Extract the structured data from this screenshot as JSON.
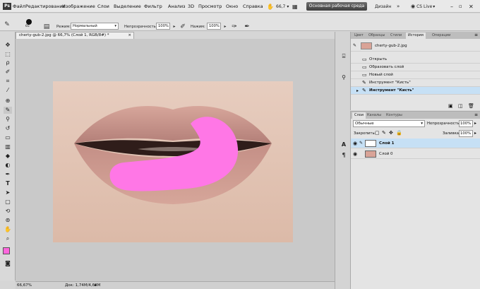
{
  "menubar": {
    "app_logo": "Ps",
    "items": [
      "Файл",
      "Редактирование",
      "Изображение",
      "Слои",
      "Выделение",
      "Фильтр",
      "Анализ",
      "3D",
      "Просмотр",
      "Окно",
      "Справка"
    ],
    "zoom": "66,7",
    "workspace": "Основная рабочая среда",
    "design": "Дизайн",
    "cs_live": "CS Live"
  },
  "options": {
    "mode_label": "Режим:",
    "mode_value": "Нормальный",
    "opacity_label": "Непрозрачность:",
    "opacity_value": "100%",
    "pressure_label": "Нажим:",
    "pressure_value": "100%",
    "brush_size": "65"
  },
  "document": {
    "tab_title": "cherty-gub-2.jpg @ 66,7% (Слой 1, RGB/8#) *",
    "close": "×"
  },
  "status": {
    "zoom": "66,67%",
    "doc_info": "Док: 1,74M/4,68M"
  },
  "history": {
    "tabs": [
      "Цвет",
      "Образцы",
      "Стили",
      "История",
      "Операции"
    ],
    "snapshot": "cherty-gub-2.jpg",
    "rows": [
      "Открыть",
      "Образовать слой",
      "Новый слой",
      "Инструмент \"Кисть\"",
      "Инструмент \"Кисть\""
    ]
  },
  "layers": {
    "tabs": [
      "Слои",
      "Каналы",
      "Контуры"
    ],
    "blend_mode": "Обычные",
    "opacity_label": "Непрозрачность:",
    "opacity_value": "100%",
    "lock_label": "Закрепить:",
    "fill_label": "Заливка:",
    "fill_value": "100%",
    "rows": [
      "Слой 1",
      "Слой 0"
    ]
  },
  "colors": {
    "foreground": "#ff66dd",
    "highlight": "#c6e0f5",
    "brush_stroke": "#ff77e6"
  }
}
